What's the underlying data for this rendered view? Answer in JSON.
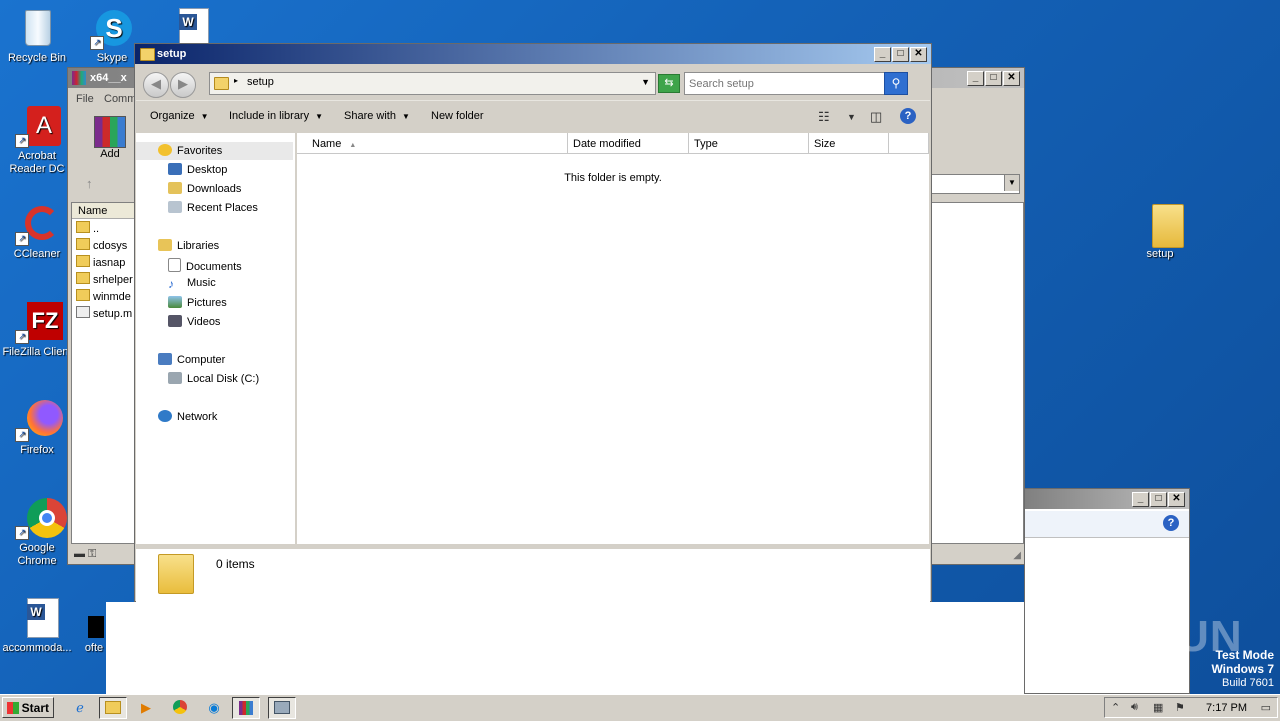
{
  "desktop": {
    "icons": [
      {
        "label": "Recycle Bin"
      },
      {
        "label": "Skype"
      },
      {
        "label": "Acrobat Reader DC"
      },
      {
        "label": "CCleaner"
      },
      {
        "label": "FileZilla Client"
      },
      {
        "label": "Firefox"
      },
      {
        "label": "Google Chrome"
      },
      {
        "label": "accommoda..."
      },
      {
        "label": "ofte"
      },
      {
        "label": "setup"
      }
    ]
  },
  "explorer": {
    "title": "setup",
    "address_path": "setup",
    "search_placeholder": "Search setup",
    "commands": {
      "organize": "Organize",
      "include_in_library": "Include in library",
      "share_with": "Share with",
      "new_folder": "New folder"
    },
    "nav": {
      "favorites": "Favorites",
      "desktop": "Desktop",
      "downloads": "Downloads",
      "recent_places": "Recent Places",
      "libraries": "Libraries",
      "documents": "Documents",
      "music": "Music",
      "pictures": "Pictures",
      "videos": "Videos",
      "computer": "Computer",
      "local_disk": "Local Disk (C:)",
      "network": "Network"
    },
    "columns": {
      "name": "Name",
      "date_modified": "Date modified",
      "type": "Type",
      "size": "Size"
    },
    "empty_message": "This folder is empty.",
    "item_count": "0 items"
  },
  "winrar": {
    "title": "x64__x",
    "menu_file": "File",
    "menu_commands": "Comm",
    "add_label": "Add",
    "col_name": "Name",
    "rows": [
      "..",
      "cdosys",
      "iasnap",
      "srhelper",
      "winmde",
      "setup.m"
    ]
  },
  "watermark": "ANY RUN",
  "test_mode": {
    "line1": "Test Mode",
    "line2": "Windows 7",
    "line3": "Build 7601"
  },
  "taskbar": {
    "start_label": "Start",
    "clock": "7:17 PM"
  }
}
